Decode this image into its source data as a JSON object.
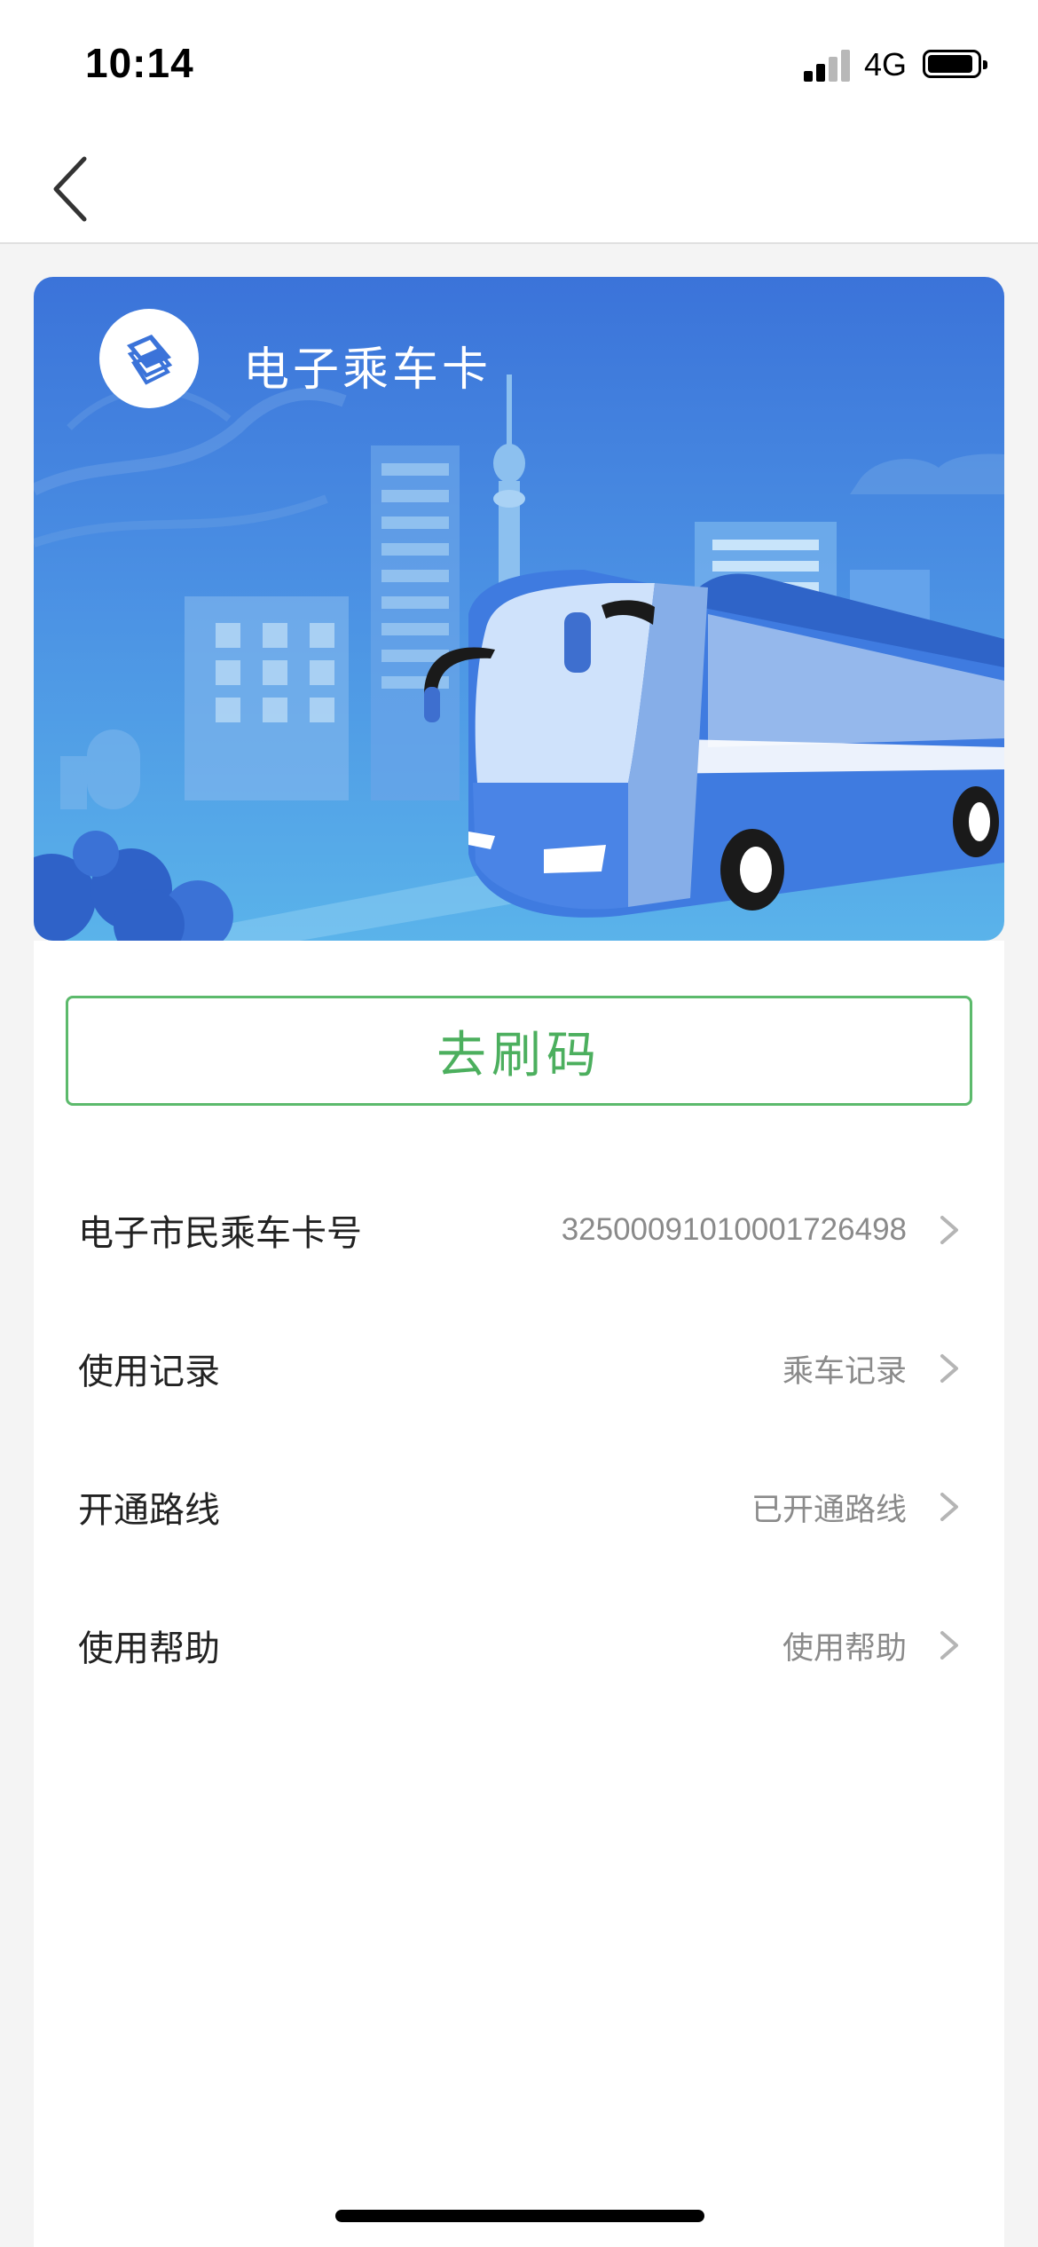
{
  "status_bar": {
    "time": "10:14",
    "network": "4G",
    "signal_bars_active": 2,
    "signal_bars_total": 4,
    "battery_icon": "battery-full-icon"
  },
  "nav": {
    "back_icon": "chevron-left-icon"
  },
  "card": {
    "title": "电子乘车卡",
    "logo_icon": "transit-card-logo-icon",
    "illustration": "bus-city-illustration",
    "colors": {
      "top": "#3b73d9",
      "bottom": "#5ab3ea"
    }
  },
  "primary_action": {
    "label": "去刷码",
    "color": "#4caf5e"
  },
  "rows": [
    {
      "label": "电子市民乘车卡号",
      "value": "3250009101000172649​8"
    },
    {
      "label": "使用记录",
      "value": "乘车记录"
    },
    {
      "label": "开通路线",
      "value": "已开通路线"
    },
    {
      "label": "使用帮助",
      "value": "使用帮助"
    }
  ]
}
